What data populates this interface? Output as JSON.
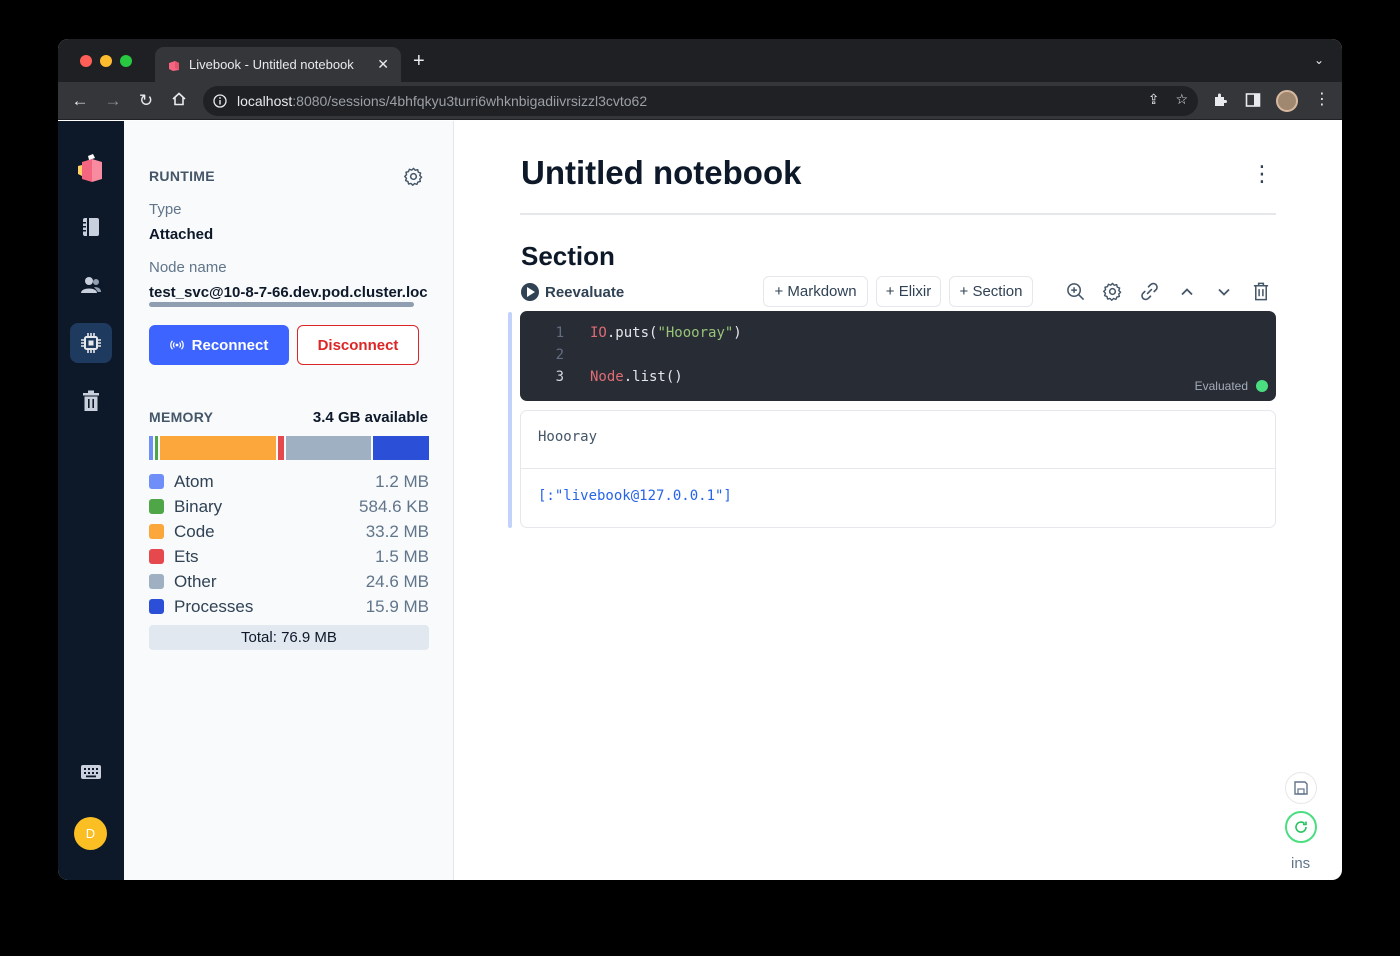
{
  "browser": {
    "tab_title": "Livebook - Untitled notebook",
    "url_host": "localhost",
    "url_rest": ":8080/sessions/4bhfqkyu3turri6whknbigadiivrsizzl3cvto62"
  },
  "runtime": {
    "heading": "RUNTIME",
    "type_label": "Type",
    "type_value": "Attached",
    "node_label": "Node name",
    "node_value": "test_svc@10-8-7-66.dev.pod.cluster.loc",
    "reconnect_label": "Reconnect",
    "disconnect_label": "Disconnect"
  },
  "memory": {
    "heading": "MEMORY",
    "available": "3.4 GB available",
    "items": [
      {
        "name": "Atom",
        "amount": "1.2 MB",
        "color": "#6f8ef7",
        "fraction": 0.016
      },
      {
        "name": "Binary",
        "amount": "584.6 KB",
        "color": "#4ea646",
        "fraction": 0.008
      },
      {
        "name": "Code",
        "amount": "33.2 MB",
        "color": "#fba73c",
        "fraction": 0.432
      },
      {
        "name": "Ets",
        "amount": "1.5 MB",
        "color": "#e5484d",
        "fraction": 0.02
      },
      {
        "name": "Other",
        "amount": "24.6 MB",
        "color": "#9fb0c2",
        "fraction": 0.32
      },
      {
        "name": "Processes",
        "amount": "15.9 MB",
        "color": "#2c4fd8",
        "fraction": 0.207
      }
    ],
    "total": "Total: 76.9 MB"
  },
  "notebook": {
    "title": "Untitled notebook",
    "section_title": "Section",
    "reevaluate_label": "Reevaluate",
    "insert_markdown": "+ Markdown",
    "insert_elixir": "+ Elixir",
    "insert_section": "+ Section",
    "code": {
      "line1_num": "1",
      "line1_mod": "IO",
      "line1_fn": ".puts(",
      "line1_str": "\"Hoooray\"",
      "line1_end": ")",
      "line2_num": "2",
      "line3_num": "3",
      "line3_mod": "Node",
      "line3_fn": ".list()"
    },
    "status": "Evaluated",
    "output_text": "Hoooray",
    "output_list": "[:\"livebook@127.0.0.1\"]"
  },
  "user_initial": "D",
  "ins_label": "ins"
}
